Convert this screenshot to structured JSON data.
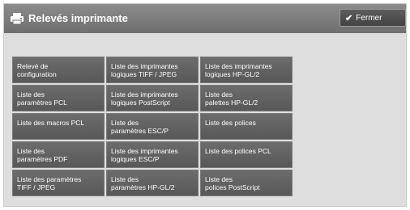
{
  "window": {
    "title": "Relevés imprimante",
    "title_icon": "printer-icon",
    "close_label": "Fermer",
    "close_icon": "checkmark-icon"
  },
  "colors": {
    "titlebar": "#7a7a7a",
    "button": "#5f5f5f",
    "background": "#dedede"
  },
  "reports": [
    "Relevé de\nconfiguration",
    "Liste des imprimantes\nlogiques TIFF / JPEG",
    "Liste des imprimantes\nlogiques HP-GL/2",
    "Liste des\nparamètres PCL",
    "Liste des imprimantes\nlogiques PostScript",
    "Liste des\npalettes HP-GL/2",
    "Liste des macros PCL",
    "Liste des\nparamètres ESC/P",
    "Liste des polices",
    "Liste des\nparamètres PDF",
    "Liste des imprimantes\nlogiques ESC/P",
    "Liste des polices PCL",
    "Liste des paramètres\nTIFF / JPEG",
    "Liste des\nparamètres HP-GL/2",
    "Liste des\npolices PostScript"
  ]
}
